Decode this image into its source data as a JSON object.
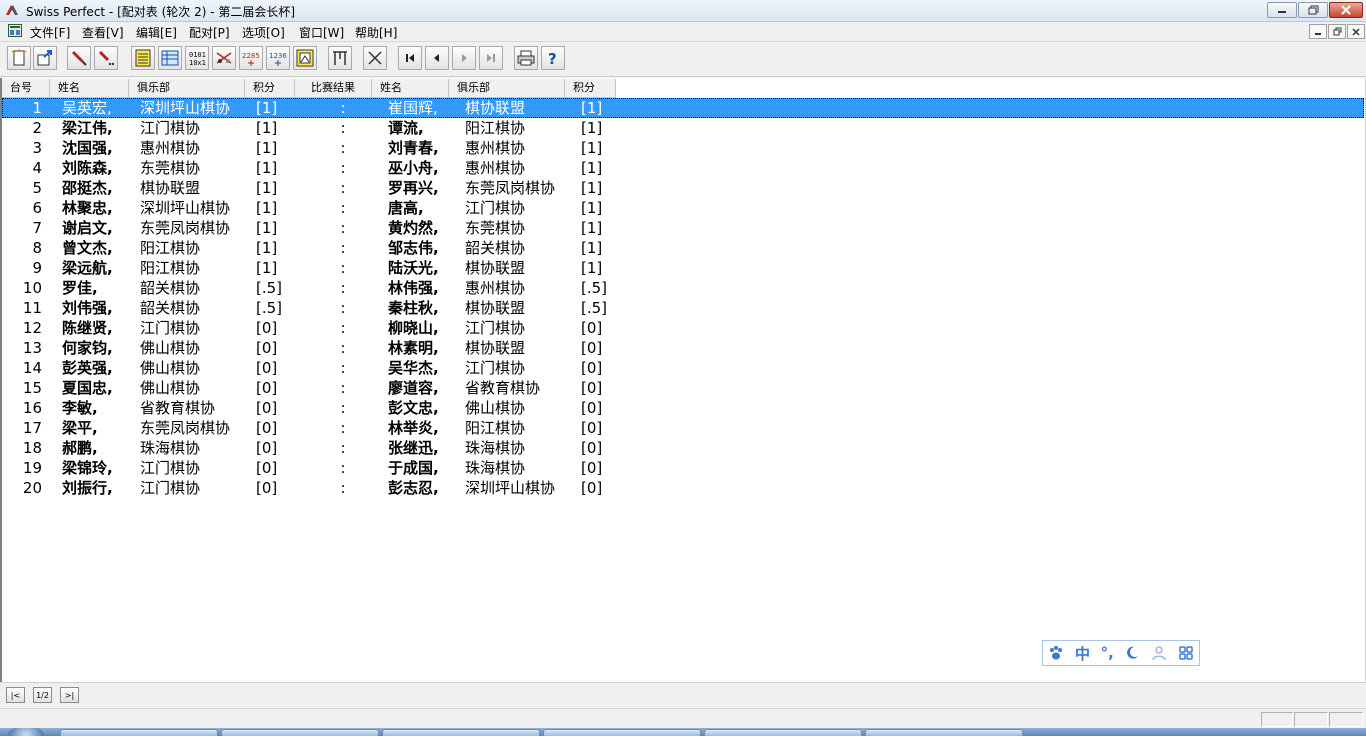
{
  "window": {
    "title": "Swiss Perfect - [配对表  (轮次 2) - 第二届会长杯]"
  },
  "menu": [
    "文件[F]",
    "查看[V]",
    "编辑[E]",
    "配对[P]",
    "选项[O]",
    "窗口[W]",
    "帮助[H]"
  ],
  "table": {
    "headers": [
      "台号",
      "姓名",
      "俱乐部",
      "积分",
      "比赛结果",
      "姓名",
      "俱乐部",
      "积分"
    ],
    "rows": [
      {
        "no": "1",
        "name1": "吴英宏,",
        "club1": "深圳坪山棋协",
        "score1": "[1]",
        "result": ":",
        "name2": "崔国辉,",
        "club2": "棋协联盟",
        "score2": "[1]"
      },
      {
        "no": "2",
        "name1": "梁江伟,",
        "club1": "江门棋协",
        "score1": "[1]",
        "result": ":",
        "name2": "谭流,",
        "club2": "阳江棋协",
        "score2": "[1]"
      },
      {
        "no": "3",
        "name1": "沈国强,",
        "club1": "惠州棋协",
        "score1": "[1]",
        "result": ":",
        "name2": "刘青春,",
        "club2": "惠州棋协",
        "score2": "[1]"
      },
      {
        "no": "4",
        "name1": "刘陈森,",
        "club1": "东莞棋协",
        "score1": "[1]",
        "result": ":",
        "name2": "巫小舟,",
        "club2": "惠州棋协",
        "score2": "[1]"
      },
      {
        "no": "5",
        "name1": "邵挺杰,",
        "club1": "棋协联盟",
        "score1": "[1]",
        "result": ":",
        "name2": "罗再兴,",
        "club2": "东莞凤岗棋协",
        "score2": "[1]"
      },
      {
        "no": "6",
        "name1": "林聚忠,",
        "club1": "深圳坪山棋协",
        "score1": "[1]",
        "result": ":",
        "name2": "唐高,",
        "club2": "江门棋协",
        "score2": "[1]"
      },
      {
        "no": "7",
        "name1": "谢启文,",
        "club1": "东莞凤岗棋协",
        "score1": "[1]",
        "result": ":",
        "name2": "黄灼然,",
        "club2": "东莞棋协",
        "score2": "[1]"
      },
      {
        "no": "8",
        "name1": "曾文杰,",
        "club1": "阳江棋协",
        "score1": "[1]",
        "result": ":",
        "name2": "邹志伟,",
        "club2": "韶关棋协",
        "score2": "[1]"
      },
      {
        "no": "9",
        "name1": "梁远航,",
        "club1": "阳江棋协",
        "score1": "[1]",
        "result": ":",
        "name2": "陆沃光,",
        "club2": "棋协联盟",
        "score2": "[1]"
      },
      {
        "no": "10",
        "name1": "罗佳,",
        "club1": "韶关棋协",
        "score1": "[.5]",
        "result": ":",
        "name2": "林伟强,",
        "club2": "惠州棋协",
        "score2": "[.5]"
      },
      {
        "no": "11",
        "name1": "刘伟强,",
        "club1": "韶关棋协",
        "score1": "[.5]",
        "result": ":",
        "name2": "秦柱秋,",
        "club2": "棋协联盟",
        "score2": "[.5]"
      },
      {
        "no": "12",
        "name1": "陈继贤,",
        "club1": "江门棋协",
        "score1": "[0]",
        "result": ":",
        "name2": "柳晓山,",
        "club2": "江门棋协",
        "score2": "[0]"
      },
      {
        "no": "13",
        "name1": "何家钧,",
        "club1": "佛山棋协",
        "score1": "[0]",
        "result": ":",
        "name2": "林素明,",
        "club2": "棋协联盟",
        "score2": "[0]"
      },
      {
        "no": "14",
        "name1": "彭英强,",
        "club1": "佛山棋协",
        "score1": "[0]",
        "result": ":",
        "name2": "吴华杰,",
        "club2": "江门棋协",
        "score2": "[0]"
      },
      {
        "no": "15",
        "name1": "夏国忠,",
        "club1": "佛山棋协",
        "score1": "[0]",
        "result": ":",
        "name2": "廖道容,",
        "club2": "省教育棋协",
        "score2": "[0]"
      },
      {
        "no": "16",
        "name1": "李敏,",
        "club1": "省教育棋协",
        "score1": "[0]",
        "result": ":",
        "name2": "彭文忠,",
        "club2": "佛山棋协",
        "score2": "[0]"
      },
      {
        "no": "17",
        "name1": "梁平,",
        "club1": "东莞凤岗棋协",
        "score1": "[0]",
        "result": ":",
        "name2": "林举炎,",
        "club2": "阳江棋协",
        "score2": "[0]"
      },
      {
        "no": "18",
        "name1": "郝鹏,",
        "club1": "珠海棋协",
        "score1": "[0]",
        "result": ":",
        "name2": "张继迅,",
        "club2": "珠海棋协",
        "score2": "[0]"
      },
      {
        "no": "19",
        "name1": "梁锦玲,",
        "club1": "江门棋协",
        "score1": "[0]",
        "result": ":",
        "name2": "于成国,",
        "club2": "珠海棋协",
        "score2": "[0]"
      },
      {
        "no": "20",
        "name1": "刘振行,",
        "club1": "江门棋协",
        "score1": "[0]",
        "result": ":",
        "name2": "彭志忍,",
        "club2": "深圳坪山棋协",
        "score2": "[0]"
      }
    ],
    "selected_row": 0
  },
  "bottom_nav": [
    "|<",
    "1/2",
    ">|"
  ],
  "ime_bar": {
    "mode": "中",
    "punct": "°,",
    "icons": [
      "paw-icon",
      "moon-icon",
      "person-icon",
      "grid-icon"
    ]
  },
  "colors": {
    "selection": "#3399ff",
    "ime_blue": "#3a78d6"
  }
}
